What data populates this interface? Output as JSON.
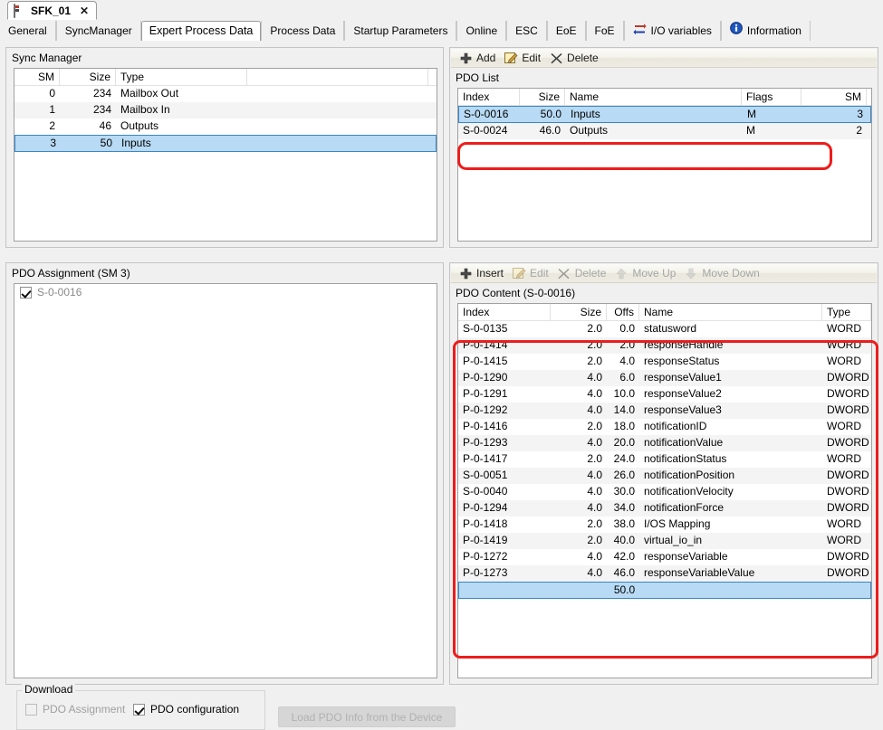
{
  "document_tab": {
    "label": "SFK_01",
    "close_label": "✕",
    "icon": "device-icon"
  },
  "property_tabs": [
    {
      "label": "General",
      "active": false,
      "icon": null
    },
    {
      "label": "SyncManager",
      "active": false,
      "icon": null
    },
    {
      "label": "Expert Process Data",
      "active": true,
      "icon": null
    },
    {
      "label": "Process Data",
      "active": false,
      "icon": null
    },
    {
      "label": "Startup Parameters",
      "active": false,
      "icon": null
    },
    {
      "label": "Online",
      "active": false,
      "icon": null
    },
    {
      "label": "ESC",
      "active": false,
      "icon": null
    },
    {
      "label": "EoE",
      "active": false,
      "icon": null
    },
    {
      "label": "FoE",
      "active": false,
      "icon": null
    },
    {
      "label": "I/O variables",
      "active": false,
      "icon": "io-arrows-icon"
    },
    {
      "label": "Information",
      "active": false,
      "icon": "info-icon"
    }
  ],
  "sync_manager": {
    "title": "Sync Manager",
    "columns": [
      "SM",
      "Size",
      "Type"
    ],
    "rows": [
      {
        "sm": "0",
        "size": "234",
        "type": "Mailbox Out",
        "selected": false
      },
      {
        "sm": "1",
        "size": "234",
        "type": "Mailbox In",
        "selected": false
      },
      {
        "sm": "2",
        "size": "46",
        "type": "Outputs",
        "selected": false
      },
      {
        "sm": "3",
        "size": "50",
        "type": "Inputs",
        "selected": true
      }
    ]
  },
  "pdo_assignment": {
    "title": "PDO Assignment (SM 3)",
    "items": [
      {
        "label": "S-0-0016",
        "checked": true,
        "enabled": false
      }
    ]
  },
  "download": {
    "legend": "Download",
    "pdo_assignment": {
      "label": "PDO Assignment",
      "checked": false,
      "enabled": false
    },
    "pdo_configuration": {
      "label": "PDO configuration",
      "checked": true,
      "enabled": true
    },
    "load_button": {
      "label": "Load PDO Info from the Device",
      "enabled": false
    }
  },
  "pdo_list": {
    "toolbar": [
      {
        "label": "Add",
        "icon": "plus-icon",
        "enabled": true
      },
      {
        "label": "Edit",
        "icon": "edit-pencil-icon",
        "enabled": true
      },
      {
        "label": "Delete",
        "icon": "x-icon",
        "enabled": true
      }
    ],
    "title": "PDO List",
    "columns": [
      "Index",
      "Size",
      "Name",
      "Flags",
      "SM"
    ],
    "rows": [
      {
        "index": "S-0-0016",
        "size": "50.0",
        "name": "Inputs",
        "flags": "M",
        "sm": "3",
        "selected": true
      },
      {
        "index": "S-0-0024",
        "size": "46.0",
        "name": "Outputs",
        "flags": "M",
        "sm": "2",
        "selected": false
      }
    ]
  },
  "pdo_content": {
    "toolbar": [
      {
        "label": "Insert",
        "icon": "plus-icon",
        "enabled": true
      },
      {
        "label": "Edit",
        "icon": "edit-pencil-icon",
        "enabled": false
      },
      {
        "label": "Delete",
        "icon": "x-icon",
        "enabled": false
      },
      {
        "label": "Move Up",
        "icon": "arrow-up-icon",
        "enabled": false
      },
      {
        "label": "Move Down",
        "icon": "arrow-down-icon",
        "enabled": false
      }
    ],
    "title": "PDO Content (S-0-0016)",
    "columns": [
      "Index",
      "Size",
      "Offs",
      "Name",
      "Type"
    ],
    "rows": [
      {
        "index": "S-0-0135",
        "size": "2.0",
        "offs": "0.0",
        "name": "statusword",
        "type": "WORD",
        "selected": false
      },
      {
        "index": "P-0-1414",
        "size": "2.0",
        "offs": "2.0",
        "name": "responseHandle",
        "type": "WORD",
        "selected": false
      },
      {
        "index": "P-0-1415",
        "size": "2.0",
        "offs": "4.0",
        "name": "responseStatus",
        "type": "WORD",
        "selected": false
      },
      {
        "index": "P-0-1290",
        "size": "4.0",
        "offs": "6.0",
        "name": "responseValue1",
        "type": "DWORD",
        "selected": false
      },
      {
        "index": "P-0-1291",
        "size": "4.0",
        "offs": "10.0",
        "name": "responseValue2",
        "type": "DWORD",
        "selected": false
      },
      {
        "index": "P-0-1292",
        "size": "4.0",
        "offs": "14.0",
        "name": "responseValue3",
        "type": "DWORD",
        "selected": false
      },
      {
        "index": "P-0-1416",
        "size": "2.0",
        "offs": "18.0",
        "name": "notificationID",
        "type": "WORD",
        "selected": false
      },
      {
        "index": "P-0-1293",
        "size": "4.0",
        "offs": "20.0",
        "name": "notificationValue",
        "type": "DWORD",
        "selected": false
      },
      {
        "index": "P-0-1417",
        "size": "2.0",
        "offs": "24.0",
        "name": "notificationStatus",
        "type": "WORD",
        "selected": false
      },
      {
        "index": "S-0-0051",
        "size": "4.0",
        "offs": "26.0",
        "name": "notificationPosition",
        "type": "DWORD",
        "selected": false
      },
      {
        "index": "S-0-0040",
        "size": "4.0",
        "offs": "30.0",
        "name": "notificationVelocity",
        "type": "DWORD",
        "selected": false
      },
      {
        "index": "P-0-1294",
        "size": "4.0",
        "offs": "34.0",
        "name": "notificationForce",
        "type": "DWORD",
        "selected": false
      },
      {
        "index": "P-0-1418",
        "size": "2.0",
        "offs": "38.0",
        "name": "I/OS Mapping",
        "type": "WORD",
        "selected": false
      },
      {
        "index": "P-0-1419",
        "size": "2.0",
        "offs": "40.0",
        "name": "virtual_io_in",
        "type": "WORD",
        "selected": false
      },
      {
        "index": "P-0-1272",
        "size": "4.0",
        "offs": "42.0",
        "name": "responseVariable",
        "type": "DWORD",
        "selected": false
      },
      {
        "index": "P-0-1273",
        "size": "4.0",
        "offs": "46.0",
        "name": "responseVariableValue",
        "type": "DWORD",
        "selected": false
      },
      {
        "index": "",
        "size": "",
        "offs": "50.0",
        "name": "",
        "type": "",
        "selected": true
      }
    ]
  }
}
